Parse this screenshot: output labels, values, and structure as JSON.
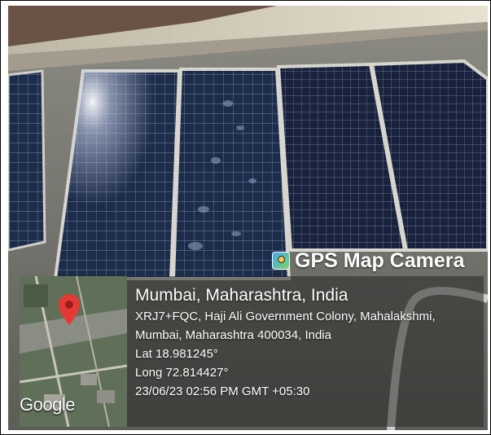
{
  "overlay": {
    "brand": "GPS Map Camera",
    "brand_icon": "gps-map-camera-app-icon",
    "map_watermark": "Google",
    "location_title": "Mumbai, Maharashtra, India",
    "address_line1": "XRJ7+FQC, Haji Ali Government Colony, Mahalakshmi,",
    "address_line2": "Mumbai, Maharashtra 400034, India",
    "latitude": "Lat 18.981245°",
    "longitude": "Long 72.814427°",
    "timestamp": "23/06/23 02:56 PM GMT +05:30"
  },
  "colors": {
    "panel_dark": "#1c2a44",
    "panel_frame": "#b8b8b0",
    "pin": "#e53935"
  }
}
